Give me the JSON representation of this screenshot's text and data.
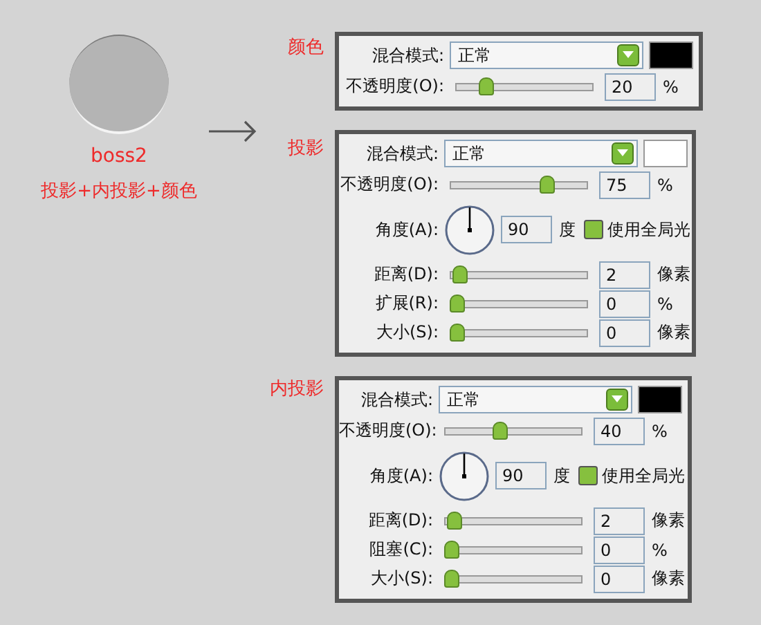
{
  "preview": {
    "name": "boss2",
    "caption": "投影+内投影+颜色"
  },
  "sections": [
    {
      "title": "颜色",
      "blend": {
        "label": "混合模式:",
        "value": "正常"
      },
      "swatch": {
        "color": "#000000"
      },
      "rows": [
        {
          "kind": "slider",
          "label": "不透明度(O):",
          "level": 0.2,
          "value": "20",
          "unit": "%"
        }
      ]
    },
    {
      "title": "投影",
      "blend": {
        "label": "混合模式:",
        "value": "正常"
      },
      "swatch": {
        "color": "#ffffff"
      },
      "rows": [
        {
          "kind": "slider",
          "label": "不透明度(O):",
          "level": 0.75,
          "value": "75",
          "unit": "%"
        },
        {
          "kind": "angle",
          "label": "角度(A):",
          "value": "90",
          "unit": "度",
          "checkbox": {
            "label": "使用全局光",
            "checked": true
          }
        },
        {
          "kind": "slider",
          "label": "距离(D):",
          "level": 0.02,
          "value": "2",
          "unit": "像素"
        },
        {
          "kind": "slider",
          "label": "扩展(R):",
          "level": 0,
          "value": "0",
          "unit": "%"
        },
        {
          "kind": "slider",
          "label": "大小(S):",
          "level": 0,
          "value": "0",
          "unit": "像素"
        }
      ]
    },
    {
      "title": "内投影",
      "blend": {
        "label": "混合模式:",
        "value": "正常"
      },
      "swatch": {
        "color": "#000000"
      },
      "rows": [
        {
          "kind": "slider",
          "label": "不透明度(O):",
          "level": 0.4,
          "value": "40",
          "unit": "%"
        },
        {
          "kind": "angle",
          "label": "角度(A):",
          "value": "90",
          "unit": "度",
          "checkbox": {
            "label": "使用全局光",
            "checked": true
          }
        },
        {
          "kind": "slider",
          "label": "距离(D):",
          "level": 0.02,
          "value": "2",
          "unit": "像素"
        },
        {
          "kind": "slider",
          "label": "阻塞(C):",
          "level": 0,
          "value": "0",
          "unit": "%"
        },
        {
          "kind": "slider",
          "label": "大小(S):",
          "level": 0,
          "value": "0",
          "unit": "像素"
        }
      ]
    }
  ]
}
